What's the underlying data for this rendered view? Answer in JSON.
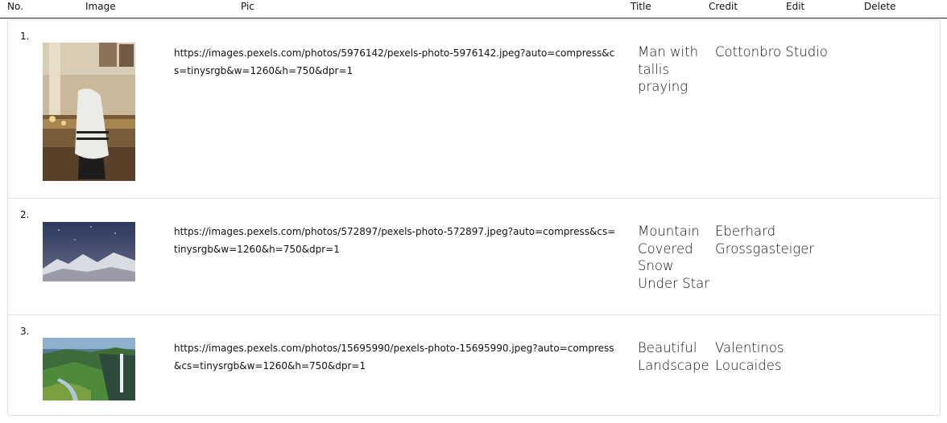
{
  "columns": {
    "no": "No.",
    "image": "Image",
    "pic": "Pic",
    "title": "Title",
    "credit": "Credit",
    "edit": "Edit",
    "delete": "Delete"
  },
  "rows": [
    {
      "no": "1.",
      "pic": "https://images.pexels.com/photos/5976142/pexels-photo-5976142.jpeg?auto=compress&cs=tinysrgb&w=1260&h=750&dpr=1",
      "title": "Man with tallis praying",
      "credit": "Cottonbro Studio",
      "image_icon": "photo-thumbnail-icon"
    },
    {
      "no": "2.",
      "pic": "https://images.pexels.com/photos/572897/pexels-photo-572897.jpeg?auto=compress&cs=tinysrgb&w=1260&h=750&dpr=1",
      "title": "Mountain Covered Snow Under Star",
      "credit": "Eberhard Grossgasteiger",
      "image_icon": "photo-thumbnail-icon"
    },
    {
      "no": "3.",
      "pic": "https://images.pexels.com/photos/15695990/pexels-photo-15695990.jpeg?auto=compress&cs=tinysrgb&w=1260&h=750&dpr=1",
      "title": "Beautiful Landscape",
      "credit": "Valentinos Loucaides",
      "image_icon": "photo-thumbnail-icon"
    }
  ]
}
